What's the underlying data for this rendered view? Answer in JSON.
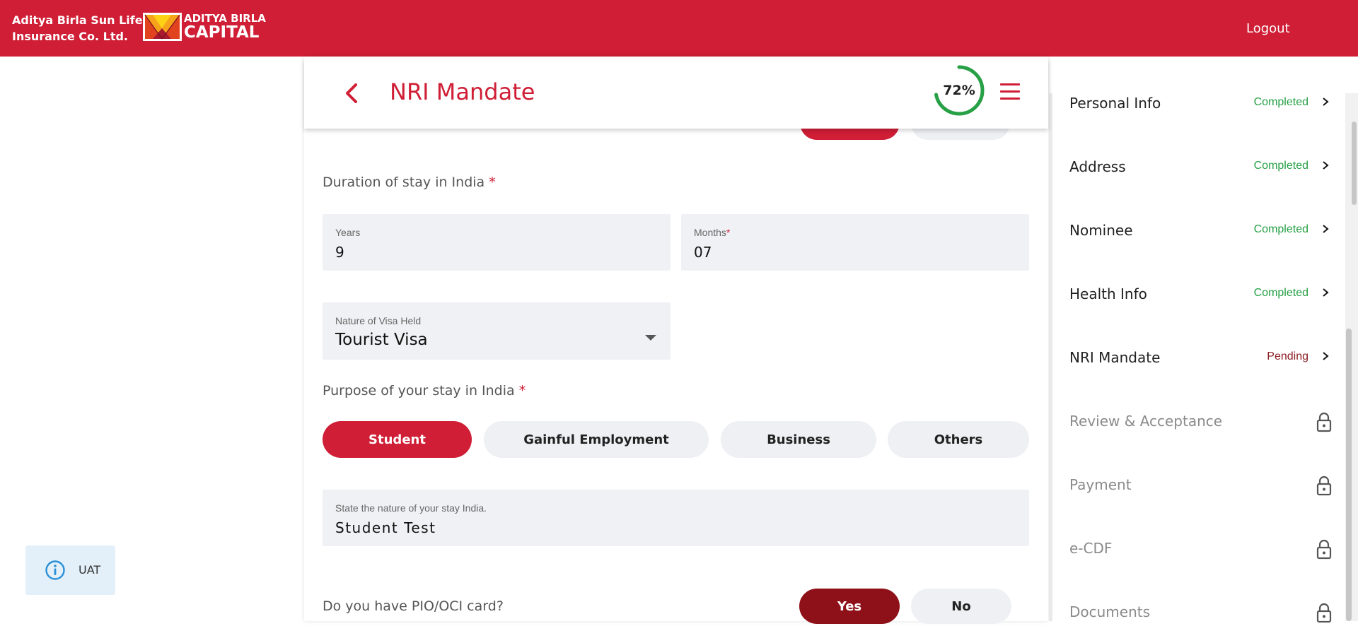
{
  "header": {
    "brand_line1": "Aditya Birla Sun Life",
    "brand_line2": "Insurance Co. Ltd.",
    "logo_line1": "ADITYA BIRLA",
    "logo_line2": "CAPITAL",
    "logout_label": "Logout",
    "brand_color": "#cf1e35"
  },
  "page": {
    "title": "NRI Mandate",
    "progress_label": "72%",
    "progress_value": 0.72
  },
  "form": {
    "duration_label": "Duration of stay in India",
    "required_mark": "*",
    "years_label": "Years",
    "years_value": "9",
    "months_label": "Months",
    "months_value": "07",
    "visa_label": "Nature of Visa Held",
    "visa_value": "Tourist Visa",
    "purpose_label": "Purpose of your stay in India",
    "purpose_options": [
      "Student",
      "Gainful Employment",
      "Business",
      "Others"
    ],
    "purpose_selected": "Student",
    "nature_label": "State the nature of your stay India.",
    "nature_value": "Student Test",
    "pio_label": "Do you have PIO/OCI card?",
    "pio_yes": "Yes",
    "pio_no": "No"
  },
  "sidebar": {
    "items": [
      {
        "label": "Personal Info",
        "status": "Completed",
        "state": "completed"
      },
      {
        "label": "Address",
        "status": "Completed",
        "state": "completed"
      },
      {
        "label": "Nominee",
        "status": "Completed",
        "state": "completed"
      },
      {
        "label": "Health Info",
        "status": "Completed",
        "state": "completed"
      },
      {
        "label": "NRI Mandate",
        "status": "Pending",
        "state": "pending"
      },
      {
        "label": "Review & Acceptance",
        "status": "",
        "state": "locked"
      },
      {
        "label": "Payment",
        "status": "",
        "state": "locked"
      },
      {
        "label": "e-CDF",
        "status": "",
        "state": "locked"
      },
      {
        "label": "Documents",
        "status": "",
        "state": "locked"
      }
    ]
  },
  "uat": {
    "label": "UAT",
    "icon": "info-icon"
  },
  "colors": {
    "accent": "#cf1e35",
    "completed": "#27a046",
    "pending": "#8b1d24",
    "selected_dark": "#8e1119"
  }
}
